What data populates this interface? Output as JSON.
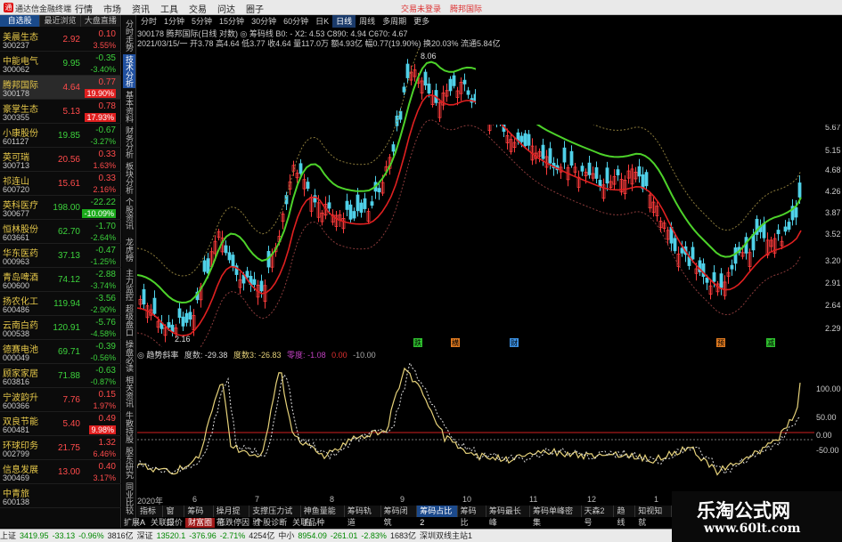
{
  "app": {
    "title": "通达信金融终端",
    "menus": [
      "行情",
      "市场",
      "资讯",
      "工具",
      "交易",
      "问达",
      "圈子"
    ],
    "right_links": [
      "交易未登录",
      "腾邦国际"
    ]
  },
  "left": {
    "tabs": [
      "自选股",
      "最近浏览",
      "大盘直播"
    ],
    "stocks": [
      {
        "name": "美晨生态",
        "code": "300237",
        "price": "2.92",
        "chg": "0.10",
        "pct": "3.55%",
        "dir": "up"
      },
      {
        "name": "中能电气",
        "code": "300062",
        "price": "9.95",
        "chg": "-0.35",
        "pct": "-3.40%",
        "dir": "dn"
      },
      {
        "name": "腾邦国际",
        "code": "300178",
        "price": "4.64",
        "chg": "0.77",
        "pct": "19.90%",
        "dir": "up",
        "sel": true,
        "hl": true
      },
      {
        "name": "豪掌生态",
        "code": "300355",
        "price": "5.13",
        "chg": "0.78",
        "pct": "17.93%",
        "dir": "up",
        "hl": true
      },
      {
        "name": "小康股份",
        "code": "601127",
        "price": "19.85",
        "chg": "-0.67",
        "pct": "-3.27%",
        "dir": "dn"
      },
      {
        "name": "英可瑞",
        "code": "300713",
        "price": "20.56",
        "chg": "0.33",
        "pct": "1.63%",
        "dir": "up"
      },
      {
        "name": "祁连山",
        "code": "600720",
        "price": "15.61",
        "chg": "0.33",
        "pct": "2.16%",
        "dir": "up"
      },
      {
        "name": "英科医疗",
        "code": "300677",
        "price": "198.00",
        "chg": "-22.22",
        "pct": "-10.09%",
        "dir": "dn",
        "hl": true
      },
      {
        "name": "恒林股份",
        "code": "603661",
        "price": "62.70",
        "chg": "-1.70",
        "pct": "-2.64%",
        "dir": "dn"
      },
      {
        "name": "华东医药",
        "code": "000963",
        "price": "37.13",
        "chg": "-0.47",
        "pct": "-1.25%",
        "dir": "dn"
      },
      {
        "name": "青岛啤酒",
        "code": "600600",
        "price": "74.12",
        "chg": "-2.88",
        "pct": "-3.74%",
        "dir": "dn"
      },
      {
        "name": "扬农化工",
        "code": "600486",
        "price": "119.94",
        "chg": "-3.56",
        "pct": "-2.90%",
        "dir": "dn"
      },
      {
        "name": "云南白药",
        "code": "000538",
        "price": "120.91",
        "chg": "-5.76",
        "pct": "-4.58%",
        "dir": "dn"
      },
      {
        "name": "德赛电池",
        "code": "000049",
        "price": "69.71",
        "chg": "-0.39",
        "pct": "-0.56%",
        "dir": "dn"
      },
      {
        "name": "顾家家居",
        "code": "603816",
        "price": "71.88",
        "chg": "-0.63",
        "pct": "-0.87%",
        "dir": "dn"
      },
      {
        "name": "宁波韵升",
        "code": "600366",
        "price": "7.76",
        "chg": "0.15",
        "pct": "1.97%",
        "dir": "up"
      },
      {
        "name": "双良节能",
        "code": "600481",
        "price": "5.40",
        "chg": "0.49",
        "pct": "9.98%",
        "dir": "up",
        "hl": true
      },
      {
        "name": "环球印务",
        "code": "002799",
        "price": "21.75",
        "chg": "1.32",
        "pct": "6.46%",
        "dir": "up"
      },
      {
        "name": "信息发展",
        "code": "300469",
        "price": "13.00",
        "chg": "0.40",
        "pct": "3.17%",
        "dir": "up"
      },
      {
        "name": "中青旅",
        "code": "600138",
        "price": "",
        "chg": "",
        "pct": "",
        "dir": "dn"
      }
    ]
  },
  "vtabs": [
    "分时走势",
    "技术分析",
    "基本资料",
    "财务分析",
    "板块分析",
    "个股资讯",
    "龙虎榜",
    "主力监控",
    "超级盘口",
    "操盘必读",
    "相关资讯",
    "牛散持股",
    "股东研究",
    "同业比较"
  ],
  "period_tabs": [
    "分时",
    "1分钟",
    "5分钟",
    "15分钟",
    "30分钟",
    "60分钟",
    "日K",
    "日线",
    "周线",
    "多周期",
    "更多"
  ],
  "info1": "300178 腾邦国际(日线 对数) ◎ 筹码线    B0: - X2: 4.53  C890: 4.94  C670: 4.67",
  "info2": "2021/03/15/一 开3.78 高4.64 低3.77 收4.64 量117.0万 额4.93亿 幅0.77(19.90%) 换20.03% 流通5.84亿",
  "price_axis": [
    "5.67",
    "5.15",
    "4.68",
    "4.26",
    "3.87",
    "3.52",
    "3.20",
    "2.91",
    "2.64",
    "2.29"
  ],
  "peak_label": "8.06",
  "low_label": "2.16",
  "signals": [
    {
      "t": "跌",
      "c": "#2fc02f"
    },
    {
      "t": "横",
      "c": "#e07a20"
    },
    {
      "t": "财",
      "c": "#3b8fe0"
    },
    {
      "t": "预",
      "c": "#e07a20"
    },
    {
      "t": "减",
      "c": "#2fc02f"
    }
  ],
  "indicator": {
    "name": "趋势斜率",
    "v1_label": "度数:",
    "v1": "-29.38",
    "v2_label": "度数3:",
    "v2": "-26.83",
    "v3_label": "零度:",
    "v3": "-1.08",
    "v4": "0.00",
    "v5": "-10.00",
    "axis": [
      "100.00",
      "50.00",
      "0.00",
      "-50.00"
    ]
  },
  "x_axis": [
    "2020年",
    "6",
    "7",
    "8",
    "9",
    "10",
    "11",
    "12",
    "1"
  ],
  "bottom_tabs": [
    "指标A",
    "窗口",
    "筹码线",
    "操月提花",
    "支撑压力试验",
    "神鱼量能自",
    "筹码轨道",
    "筹码闭筑",
    "筹码占比2",
    "筹码比",
    "筹码最长峰",
    "筹码单峰密集",
    "天森2号",
    "趋线",
    "知视知就"
  ],
  "bottom_tabs_on": 8,
  "bottom_tabs2": [
    "扩展A",
    "关联报价",
    "财富圈",
    "涨跌停因",
    "个股诊断",
    "关联品种"
  ],
  "status": [
    {
      "t": "上证",
      "c": ""
    },
    {
      "t": "3419.95",
      "c": "g"
    },
    {
      "t": "-33.13",
      "c": "g"
    },
    {
      "t": "-0.96%",
      "c": "g"
    },
    {
      "t": "3816亿",
      "c": ""
    },
    {
      "t": "深证",
      "c": ""
    },
    {
      "t": "13520.1",
      "c": "g"
    },
    {
      "t": "-376.96",
      "c": "g"
    },
    {
      "t": "-2.71%",
      "c": "g"
    },
    {
      "t": "4254亿",
      "c": ""
    },
    {
      "t": "中小",
      "c": ""
    },
    {
      "t": "8954.09",
      "c": "g"
    },
    {
      "t": "-261.01",
      "c": "g"
    },
    {
      "t": "-2.83%",
      "c": "g"
    },
    {
      "t": "1683亿",
      "c": ""
    },
    {
      "t": "深圳双线主站1",
      "c": ""
    }
  ],
  "watermark": {
    "cn": "乐淘公式网",
    "url": "www.60lt.com"
  },
  "colors": {
    "up": "#ff4b4b",
    "down": "#3cd23c",
    "ma_green": "#4dd22a",
    "ma_red": "#e02020",
    "indicator": "#e6d27a"
  }
}
